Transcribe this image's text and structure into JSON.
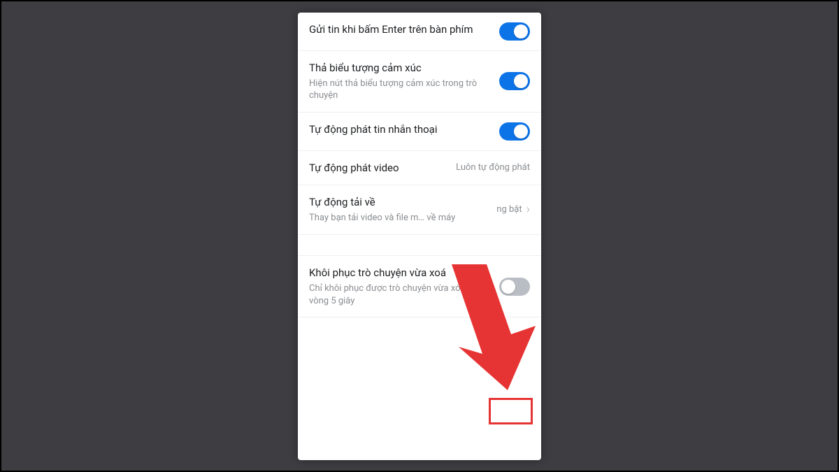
{
  "settings": {
    "items": [
      {
        "title": "Gửi tin khi bấm Enter trên bàn phím",
        "sub": "",
        "type": "toggle",
        "on": true
      },
      {
        "title": "Thả biểu tượng cảm xúc",
        "sub": "Hiện nút thả biểu tượng cảm xúc trong trò chuyện",
        "type": "toggle",
        "on": true
      },
      {
        "title": "Tự động phát tin nhắn thoại",
        "sub": "",
        "type": "toggle",
        "on": true
      },
      {
        "title": "Tự động phát video",
        "sub": "",
        "type": "value",
        "value": "Luôn tự động phát"
      },
      {
        "title": "Tự động tải về",
        "sub": "Thay bạn tải video và file m… về máy",
        "type": "value-chevron",
        "value": "ng bật"
      },
      {
        "title": "Khôi phục trò chuyện vừa xoá",
        "sub": "Chỉ khôi phục được trò chuyện vừa xóa trong vòng 5 giây",
        "type": "toggle",
        "on": false
      }
    ]
  },
  "colors": {
    "accent": "#0d74e8",
    "annotation": "#e63434"
  }
}
